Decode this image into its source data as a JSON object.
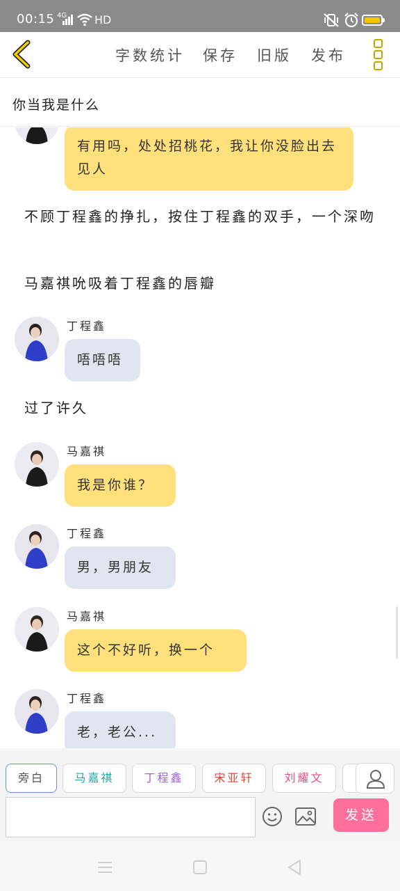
{
  "status": {
    "time": "00:15",
    "signal": "4G",
    "hd": "HD",
    "battery_color": "#f3c500"
  },
  "toolbar": {
    "actions": [
      "字数统计",
      "保存",
      "旧版",
      "发布"
    ],
    "accent": "#c9a400"
  },
  "story": {
    "title": "你当我是什么"
  },
  "chat": {
    "messages": [
      {
        "kind": "bubble",
        "color": "yellow",
        "sender": "",
        "text": "有用吗，处处招桃花，我让你没脸出去见人"
      },
      {
        "kind": "narration",
        "text": "不顾丁程鑫的挣扎，按住丁程鑫的双手，一个深吻"
      },
      {
        "kind": "narration",
        "text": "马嘉祺吮吸着丁程鑫的唇瓣"
      },
      {
        "kind": "bubble",
        "color": "gray",
        "sender": "丁程鑫",
        "text": "唔唔唔"
      },
      {
        "kind": "narration",
        "text": "过了许久"
      },
      {
        "kind": "bubble",
        "color": "yellow",
        "sender": "马嘉祺",
        "text": "我是你谁？"
      },
      {
        "kind": "bubble",
        "color": "gray",
        "sender": "丁程鑫",
        "text": "男，男朋友"
      },
      {
        "kind": "bubble",
        "color": "yellow",
        "sender": "马嘉祺",
        "text": "这个不好听，换一个"
      },
      {
        "kind": "bubble",
        "color": "gray",
        "sender": "丁程鑫",
        "text": "老，老公..."
      }
    ]
  },
  "roles": [
    {
      "label": "旁白",
      "color": "#555555"
    },
    {
      "label": "马嘉祺",
      "color": "#19a8a8"
    },
    {
      "label": "丁程鑫",
      "color": "#9a63d6"
    },
    {
      "label": "宋亚轩",
      "color": "#e0463a"
    },
    {
      "label": "刘耀文",
      "color": "#e0508a"
    }
  ],
  "input": {
    "value": "",
    "placeholder": "",
    "send_label": "发送",
    "send_color": "#ff6f9d"
  }
}
